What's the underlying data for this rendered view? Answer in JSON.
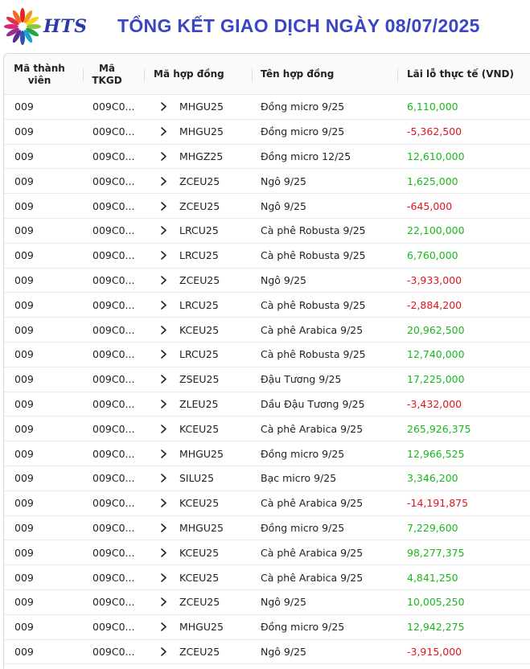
{
  "header": {
    "logo_text": "HTS",
    "title": "TỔNG KẾT GIAO DỊCH NGÀY 08/07/2025"
  },
  "table": {
    "columns": {
      "member": "Mã thành viên",
      "account": "Mã TKGD",
      "contract_code": "Mã hợp đồng",
      "contract_name": "Tên hợp đồng",
      "pnl": "Lãi lỗ thực tế (VND)"
    },
    "rows": [
      {
        "member": "009",
        "account": "009C0...",
        "code": "MHGU25",
        "name": "Đồng micro 9/25",
        "pnl": "6,110,000",
        "sign": "pos"
      },
      {
        "member": "009",
        "account": "009C0...",
        "code": "MHGU25",
        "name": "Đồng micro 9/25",
        "pnl": "-5,362,500",
        "sign": "neg"
      },
      {
        "member": "009",
        "account": "009C0...",
        "code": "MHGZ25",
        "name": "Đồng micro 12/25",
        "pnl": "12,610,000",
        "sign": "pos"
      },
      {
        "member": "009",
        "account": "009C0...",
        "code": "ZCEU25",
        "name": "Ngô 9/25",
        "pnl": "1,625,000",
        "sign": "pos"
      },
      {
        "member": "009",
        "account": "009C0...",
        "code": "ZCEU25",
        "name": "Ngô 9/25",
        "pnl": "-645,000",
        "sign": "neg"
      },
      {
        "member": "009",
        "account": "009C0...",
        "code": "LRCU25",
        "name": "Cà phê Robusta 9/25",
        "pnl": "22,100,000",
        "sign": "pos"
      },
      {
        "member": "009",
        "account": "009C0...",
        "code": "LRCU25",
        "name": "Cà phê Robusta 9/25",
        "pnl": "6,760,000",
        "sign": "pos"
      },
      {
        "member": "009",
        "account": "009C0...",
        "code": "ZCEU25",
        "name": "Ngô 9/25",
        "pnl": "-3,933,000",
        "sign": "neg"
      },
      {
        "member": "009",
        "account": "009C0...",
        "code": "LRCU25",
        "name": "Cà phê Robusta 9/25",
        "pnl": "-2,884,200",
        "sign": "neg"
      },
      {
        "member": "009",
        "account": "009C0...",
        "code": "KCEU25",
        "name": "Cà phê Arabica 9/25",
        "pnl": "20,962,500",
        "sign": "pos"
      },
      {
        "member": "009",
        "account": "009C0...",
        "code": "LRCU25",
        "name": "Cà phê Robusta 9/25",
        "pnl": "12,740,000",
        "sign": "pos"
      },
      {
        "member": "009",
        "account": "009C0...",
        "code": "ZSEU25",
        "name": "Đậu Tương 9/25",
        "pnl": "17,225,000",
        "sign": "pos"
      },
      {
        "member": "009",
        "account": "009C0...",
        "code": "ZLEU25",
        "name": "Dầu Đậu Tương 9/25",
        "pnl": "-3,432,000",
        "sign": "neg"
      },
      {
        "member": "009",
        "account": "009C0...",
        "code": "KCEU25",
        "name": "Cà phê Arabica 9/25",
        "pnl": "265,926,375",
        "sign": "pos"
      },
      {
        "member": "009",
        "account": "009C0...",
        "code": "MHGU25",
        "name": "Đồng micro 9/25",
        "pnl": "12,966,525",
        "sign": "pos"
      },
      {
        "member": "009",
        "account": "009C0...",
        "code": "SILU25",
        "name": "Bạc micro 9/25",
        "pnl": "3,346,200",
        "sign": "pos"
      },
      {
        "member": "009",
        "account": "009C0...",
        "code": "KCEU25",
        "name": "Cà phê Arabica 9/25",
        "pnl": "-14,191,875",
        "sign": "neg"
      },
      {
        "member": "009",
        "account": "009C0...",
        "code": "MHGU25",
        "name": "Đồng micro 9/25",
        "pnl": "7,229,600",
        "sign": "pos"
      },
      {
        "member": "009",
        "account": "009C0...",
        "code": "KCEU25",
        "name": "Cà phê Arabica 9/25",
        "pnl": "98,277,375",
        "sign": "pos"
      },
      {
        "member": "009",
        "account": "009C0...",
        "code": "KCEU25",
        "name": "Cà phê Arabica 9/25",
        "pnl": "4,841,250",
        "sign": "pos"
      },
      {
        "member": "009",
        "account": "009C0...",
        "code": "ZCEU25",
        "name": "Ngô 9/25",
        "pnl": "10,005,250",
        "sign": "pos"
      },
      {
        "member": "009",
        "account": "009C0...",
        "code": "MHGU25",
        "name": "Đồng micro 9/25",
        "pnl": "12,942,275",
        "sign": "pos"
      },
      {
        "member": "009",
        "account": "009C0...",
        "code": "ZCEU25",
        "name": "Ngô 9/25",
        "pnl": "-3,915,000",
        "sign": "neg"
      }
    ]
  },
  "colors": {
    "title": "#3a45c8",
    "logo": "#2a3aa8",
    "profit": "#18b81b",
    "loss": "#e0141e",
    "header_bg": "#fafafa"
  },
  "icons": {
    "logo": "sunburst-logo-icon",
    "row_expand": "chevron-right-icon"
  }
}
